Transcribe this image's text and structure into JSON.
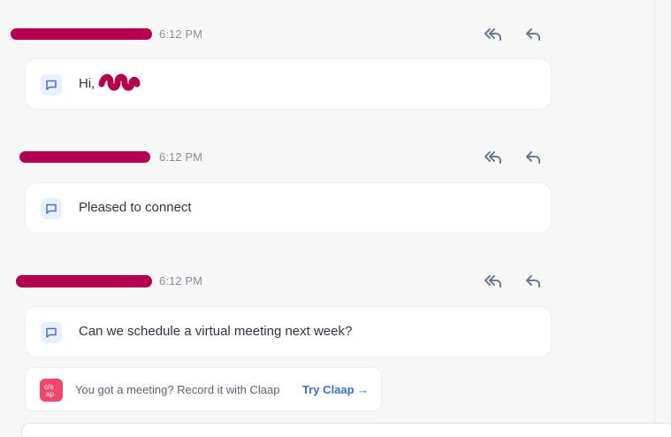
{
  "colors": {
    "background": "#f7f7f8",
    "redaction": "#b5004f",
    "link": "#3b6fd8",
    "claap_brand": "#f0476a",
    "chat_icon_bg": "#e9effc"
  },
  "messages": [
    {
      "time": "6:12 PM",
      "text": "Hi,",
      "actions": {
        "reply_all_icon": "reply-all-icon",
        "reply_icon": "reply-icon"
      }
    },
    {
      "time": "6:12 PM",
      "text": "Pleased to connect",
      "actions": {
        "reply_all_icon": "reply-all-icon",
        "reply_icon": "reply-icon"
      }
    },
    {
      "time": "6:12 PM",
      "text": "Can we schedule a virtual meeting next week?",
      "actions": {
        "reply_all_icon": "reply-all-icon",
        "reply_icon": "reply-icon"
      }
    }
  ],
  "promo": {
    "logo_icon": "claap-logo-icon",
    "logo_text": "c/a ap",
    "text": "You got a meeting? Record it with Claap",
    "link": "Try Claap →"
  },
  "icons": {
    "message": "chat-bubble-icon"
  }
}
